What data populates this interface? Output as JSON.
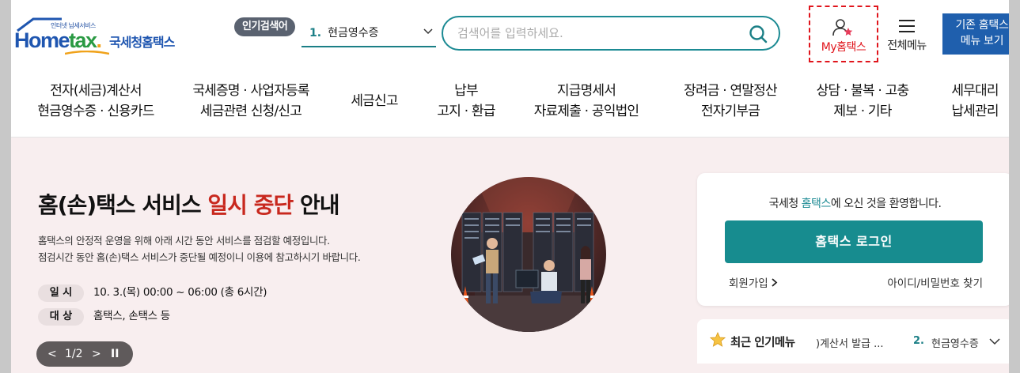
{
  "logo": {
    "small": "인터넷 납세서비스",
    "main_a": "Home",
    "main_b": "tax",
    "main_dot": ".",
    "kr": "국세청홈택스"
  },
  "header": {
    "popular_badge": "인기검색어",
    "popular_num": "1.",
    "popular_text": "현금영수증",
    "search_placeholder": "검색어를 입력하세요.",
    "my_home": "My홈택스",
    "all_menu": "전체메뉴",
    "old_home_line1": "기존 홈택스",
    "old_home_line2": "메뉴 보기"
  },
  "nav": {
    "items": [
      {
        "l1": "전자(세금)계산서",
        "l2": "현금영수증 · 신용카드"
      },
      {
        "l1": "국세증명 · 사업자등록",
        "l2": "세금관련 신청/신고"
      },
      {
        "l1": "세금신고",
        "l2": ""
      },
      {
        "l1": "납부",
        "l2": "고지 · 환급"
      },
      {
        "l1": "지급명세서",
        "l2": "자료제출 · 공익법인"
      },
      {
        "l1": "장려금 · 연말정산",
        "l2": "전자기부금"
      },
      {
        "l1": "상담 · 불복 · 고충",
        "l2": "제보 · 기타"
      },
      {
        "l1": "세무대리",
        "l2": "납세관리"
      }
    ]
  },
  "banner": {
    "title_a": "홈(손)택스 서비스 ",
    "title_red": "일시 중단",
    "title_b": " 안내",
    "desc1": "홈택스의 안정적 운영을 위해 아래 시간 동안 서비스를 점검할 예정입니다.",
    "desc2": "점검시간 동안 홈(손)택스 서비스가 중단될 예정이니 이용에 참고하시기 바랍니다.",
    "row1_tag": "일 시",
    "row1_val": "10. 3.(목) 00:00 ~ 06:00 (총 6시간)",
    "row2_tag": "대 상",
    "row2_val": "홈택스, 손택스 등",
    "pager_prev": "<",
    "pager_text": "1/2",
    "pager_next": ">",
    "pager_pause": "II"
  },
  "login": {
    "welcome_a": "국세청 ",
    "welcome_hl": "홈택스",
    "welcome_b": "에 오신 것을 환영합니다.",
    "login_button": "홈택스 로그인",
    "join": "회원가입",
    "find": "아이디/비밀번호 찾기"
  },
  "recent": {
    "title": "최근 인기메뉴",
    "item1": ")계산서 발급 ...",
    "item2_num": "2.",
    "item2": "현금영수증"
  },
  "colors": {
    "accent": "#178c8f",
    "brand": "#1f56b0",
    "alert": "#c8281e"
  }
}
